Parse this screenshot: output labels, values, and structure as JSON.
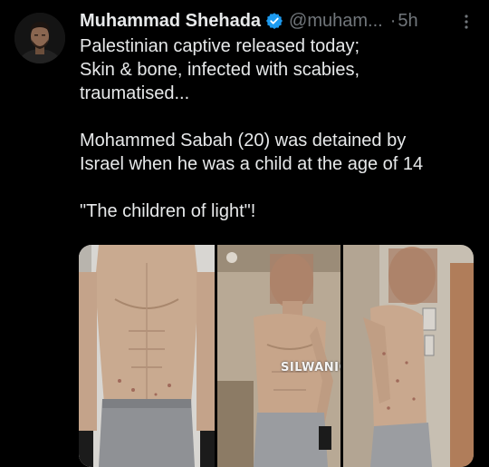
{
  "tweet": {
    "author_name": "Muhammad Shehada",
    "handle": "@muham...",
    "dot": "·",
    "time": "5h",
    "verified_icon": "verified-badge-icon",
    "more_icon": "more-options-icon",
    "lines": [
      "Palestinian captive released today;",
      "Skin & bone, infected with scabies,",
      "traumatised...",
      "",
      "Mohammed Sabah (20) was detained by",
      "Israel when he was a child at the age of 14",
      "",
      "\"The children of light\"!"
    ]
  },
  "media": {
    "watermark": "SILWANIC",
    "photos": [
      "photo-front-torso",
      "photo-side-torso",
      "photo-profile-torso"
    ]
  },
  "colors": {
    "background": "#000000",
    "text": "#e7e9ea",
    "secondary": "#71767b",
    "verified": "#1d9bf0"
  }
}
